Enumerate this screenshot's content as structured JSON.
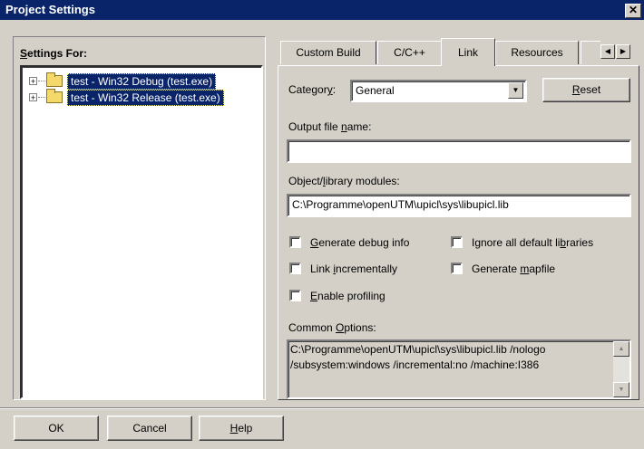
{
  "window": {
    "title": "Project Settings",
    "close_glyph": "✕"
  },
  "settings_for": {
    "label_u": "S",
    "label_rest": "ettings For:",
    "tree": [
      {
        "label": "test - Win32 Debug (test.exe)"
      },
      {
        "label": "test - Win32 Release (test.exe)"
      }
    ]
  },
  "tabs": [
    {
      "label": "Custom Build"
    },
    {
      "label": "C/C++"
    },
    {
      "label": "Link",
      "selected": true
    },
    {
      "label": "Resources"
    }
  ],
  "link": {
    "category_pre": "Categor",
    "category_u": "y",
    "category_post": ":",
    "category_value": "General",
    "reset_u": "R",
    "reset_rest": "eset",
    "output_pre": "Output file ",
    "output_u": "n",
    "output_post": "ame:",
    "output_value": "",
    "objlib_pre": "Object/",
    "objlib_u": "l",
    "objlib_post": "ibrary modules:",
    "objlib_value": "C:\\Programme\\openUTM\\upicl\\sys\\libupicl.lib",
    "checkboxes": {
      "debug": {
        "u": "G",
        "rest": "enerate debug info",
        "checked": false
      },
      "ignore_pre": "Ignore all default li",
      "ignore_u": "b",
      "ignore_post": "raries",
      "incr_pre": "Link ",
      "incr_u": "i",
      "incr_post": "ncrementally",
      "mapfile_pre": "Generate ",
      "mapfile_u": "m",
      "mapfile_post": "apfile",
      "profiling": {
        "u": "E",
        "rest": "nable profiling"
      }
    },
    "common_pre": "Common ",
    "common_u": "O",
    "common_post": "ptions:",
    "common_value": "C:\\Programme\\openUTM\\upicl\\sys\\libupicl.lib /nologo\n/subsystem:windows /incremental:no /machine:I386"
  },
  "buttons": {
    "ok": "OK",
    "cancel": "Cancel",
    "help_u": "H",
    "help_rest": "elp"
  }
}
